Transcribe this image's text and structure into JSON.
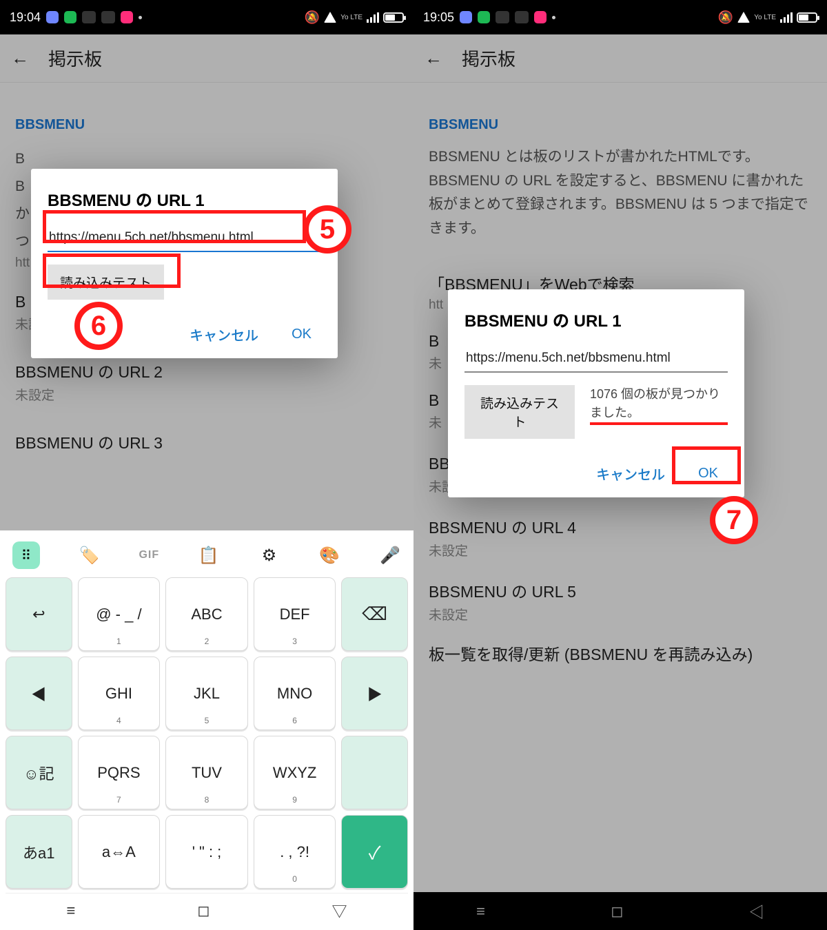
{
  "left": {
    "status_time": "19:04",
    "title": "掲示板",
    "section": "BBSMENU",
    "bg_text_prefix": "B\nB\nか\nつ",
    "dialog": {
      "title": "BBSMENU の URL 1",
      "url": "https://menu.5ch.net/bbsmenu.html",
      "test_btn": "読み込みテスト",
      "cancel": "キャンセル",
      "ok": "OK"
    },
    "partial_htt": "htt",
    "url1_title_cut": "B",
    "url1_sub": "未設定",
    "url2_title": "BBSMENU の URL 2",
    "url2_sub": "未設定",
    "url3_title": "BBSMENU の URL 3",
    "annotations": {
      "step5": "5",
      "step6": "6"
    },
    "keyboard": {
      "gif": "GIF",
      "row1": [
        "↩",
        "@ - _ /",
        "ABC",
        "DEF",
        "⌫"
      ],
      "row1_sub": [
        "",
        "1",
        "2",
        "3",
        ""
      ],
      "row2": [
        "◀",
        "GHI",
        "JKL",
        "MNO",
        "▶"
      ],
      "row2_sub": [
        "",
        "4",
        "5",
        "6",
        ""
      ],
      "row3": [
        "☺記",
        "PQRS",
        "TUV",
        "WXYZ",
        ""
      ],
      "row3_sub": [
        "",
        "7",
        "8",
        "9",
        ""
      ],
      "row4": [
        "あa1",
        "a⇔A",
        "' \" : ;",
        ". , ?!",
        "✓"
      ],
      "row4_sub": [
        "",
        "",
        "",
        "0",
        ""
      ]
    }
  },
  "right": {
    "status_time": "19:05",
    "title": "掲示板",
    "section": "BBSMENU",
    "desc": "BBSMENU とは板のリストが書かれたHTMLです。BBSMENU の URL を設定すると、BBSMENU に書かれた板がまとめて登録されます。BBSMENU は 5 つまで指定できます。",
    "websearch": "「BBSMENU」をWebで検索",
    "htt": "htt",
    "url_items": [
      {
        "title": "B",
        "sub": "未"
      },
      {
        "title": "B",
        "sub": "未"
      },
      {
        "title": "BBSMENU の URL 3",
        "sub": "未設定"
      },
      {
        "title": "BBSMENU の URL 4",
        "sub": "未設定"
      },
      {
        "title": "BBSMENU の URL 5",
        "sub": "未設定"
      }
    ],
    "refresh": "板一覧を取得/更新 (BBSMENU を再読み込み)",
    "dialog": {
      "title": "BBSMENU の URL 1",
      "url": "https://menu.5ch.net/bbsmenu.html",
      "test_btn": "読み込みテスト",
      "result": "1076 個の板が見つかりました。",
      "cancel": "キャンセル",
      "ok": "OK"
    },
    "annotations": {
      "step7": "7"
    }
  },
  "icons": {
    "vo": "Yo LTE"
  }
}
